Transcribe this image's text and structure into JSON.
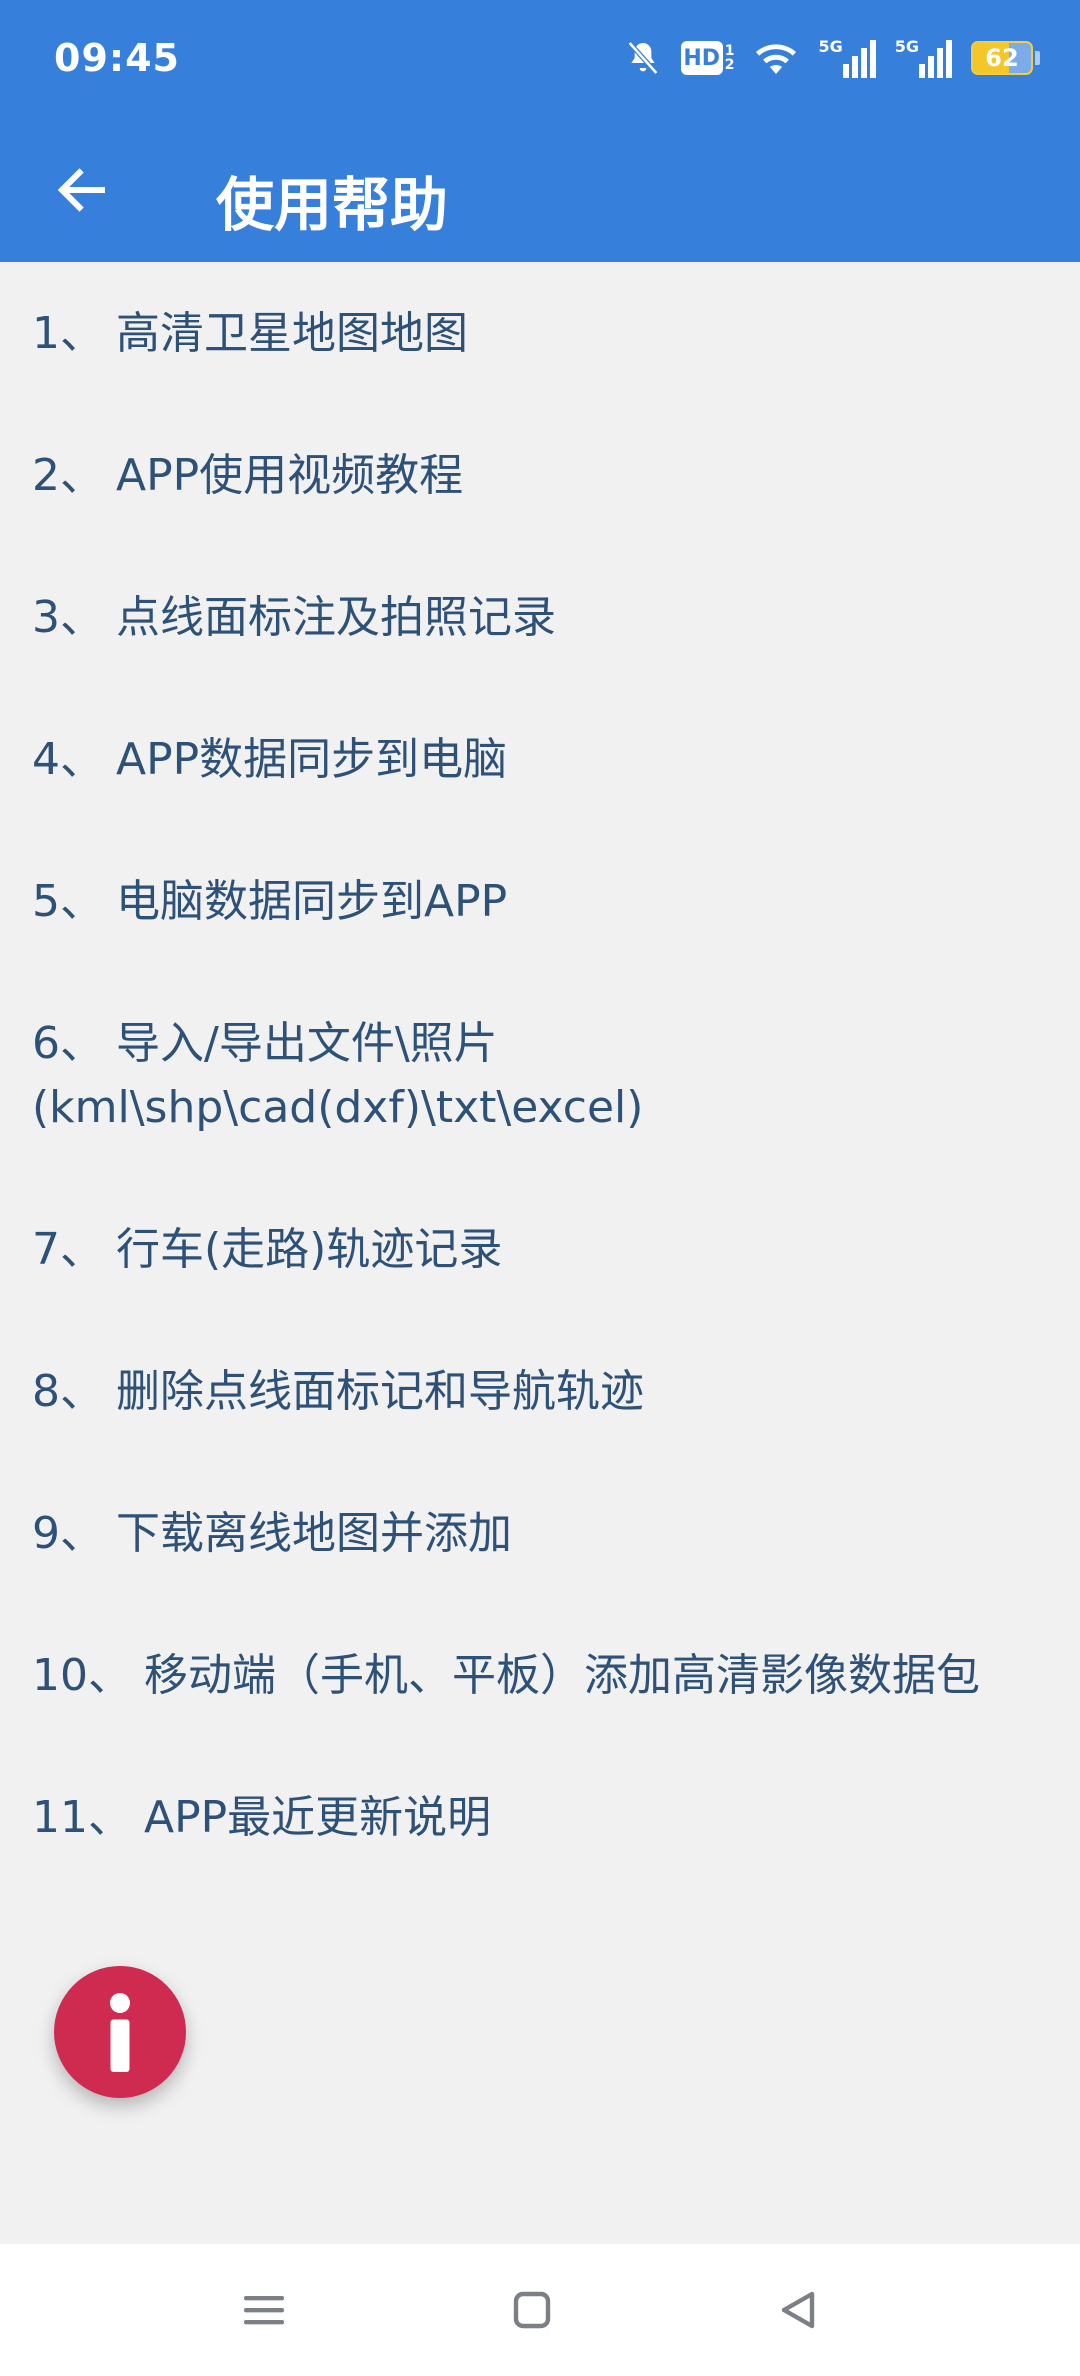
{
  "status_bar": {
    "time": "09:45",
    "hd_label": "HD",
    "hd_sub_top": "1",
    "hd_sub_bottom": "2",
    "signal1_label": "5G",
    "signal2_label": "5G",
    "battery_level": "62",
    "icons": [
      "bell-off-icon",
      "hd-icon",
      "wifi-icon",
      "signal-5g-icon",
      "signal-5g-icon",
      "battery-icon"
    ]
  },
  "app_bar": {
    "back_icon": "arrow-left-icon",
    "title": "使用帮助"
  },
  "help_items": [
    {
      "num": "1、",
      "text": "高清卫星地图地图"
    },
    {
      "num": "2、",
      "text": "APP使用视频教程"
    },
    {
      "num": "3、",
      "text": "点线面标注及拍照记录"
    },
    {
      "num": "4、",
      "text": "APP数据同步到电脑"
    },
    {
      "num": "5、",
      "text": "电脑数据同步到APP"
    },
    {
      "num": "6、",
      "text": "导入/导出文件\\照片(kml\\shp\\cad(dxf)\\txt\\excel)"
    },
    {
      "num": "7、",
      "text": "行车(走路)轨迹记录"
    },
    {
      "num": "8、",
      "text": "删除点线面标记和导航轨迹"
    },
    {
      "num": "9、",
      "text": "下载离线地图并添加"
    },
    {
      "num": "10、",
      "text": "移动端（手机、平板）添加高清影像数据包"
    },
    {
      "num": "11、",
      "text": "APP最近更新说明"
    }
  ],
  "fab": {
    "icon": "info-icon",
    "color": "#cf2a50"
  },
  "nav_bar": {
    "icons": [
      "menu-icon",
      "home-square-icon",
      "back-triangle-icon"
    ]
  },
  "colors": {
    "primary": "#3680db",
    "background": "#f1f1f2",
    "list_text": "#2e5177"
  }
}
